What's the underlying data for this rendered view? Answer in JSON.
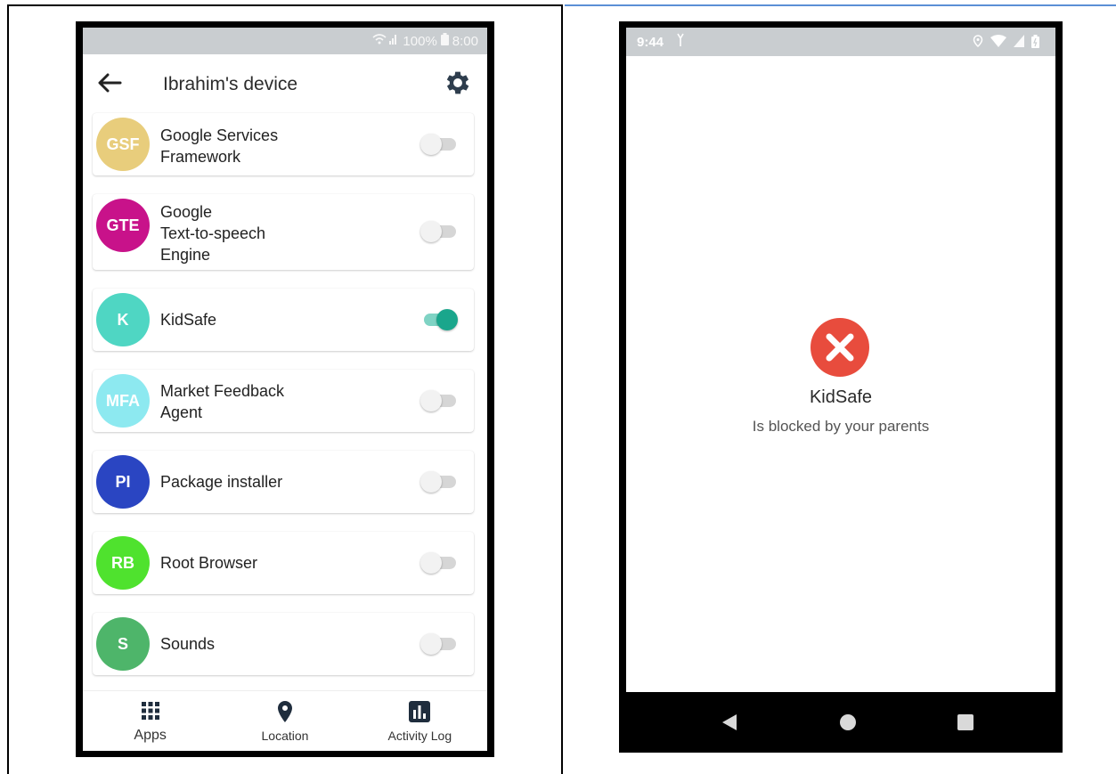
{
  "left_phone": {
    "status_bar": {
      "battery": "100%",
      "time": "8:00"
    },
    "header": {
      "title": "Ibrahim's device"
    },
    "apps": [
      {
        "initials": "GSF",
        "name": "Google Services Framework",
        "line1": "Google Services",
        "line2": "Framework",
        "line3": "",
        "color": "#e8cd7c",
        "enabled": false
      },
      {
        "initials": "GTE",
        "name": "Google Text-to-speech Engine",
        "line1": "Google",
        "line2": "Text-to-speech",
        "line3": "Engine",
        "color": "#c8128a",
        "enabled": false
      },
      {
        "initials": "K",
        "name": "KidSafe",
        "line1": "KidSafe",
        "line2": "",
        "line3": "",
        "color": "#4fd6c3",
        "enabled": true
      },
      {
        "initials": "MFA",
        "name": "Market Feedback Agent",
        "line1": "Market Feedback",
        "line2": "Agent",
        "line3": "",
        "color": "#8de9f0",
        "enabled": false
      },
      {
        "initials": "PI",
        "name": "Package installer",
        "line1": "Package installer",
        "line2": "",
        "line3": "",
        "color": "#2a45c2",
        "enabled": false
      },
      {
        "initials": "RB",
        "name": "Root Browser",
        "line1": "Root Browser",
        "line2": "",
        "line3": "",
        "color": "#4fe22e",
        "enabled": false
      },
      {
        "initials": "S",
        "name": "Sounds",
        "line1": "Sounds",
        "line2": "",
        "line3": "",
        "color": "#4eb56a",
        "enabled": false
      }
    ],
    "bottom_nav": [
      {
        "label": "Apps",
        "icon": "grid-icon"
      },
      {
        "label": "Location",
        "icon": "location-pin-icon"
      },
      {
        "label": "Activity Log",
        "icon": "bar-chart-icon"
      }
    ]
  },
  "right_phone": {
    "status_bar": {
      "time": "9:44"
    },
    "blocked": {
      "app_name": "KidSafe",
      "message": "Is blocked by your parents",
      "icon": "blocked-x-icon",
      "icon_color": "#e84c3d"
    },
    "system_nav": [
      "back-triangle-icon",
      "home-circle-icon",
      "recents-square-icon"
    ]
  }
}
